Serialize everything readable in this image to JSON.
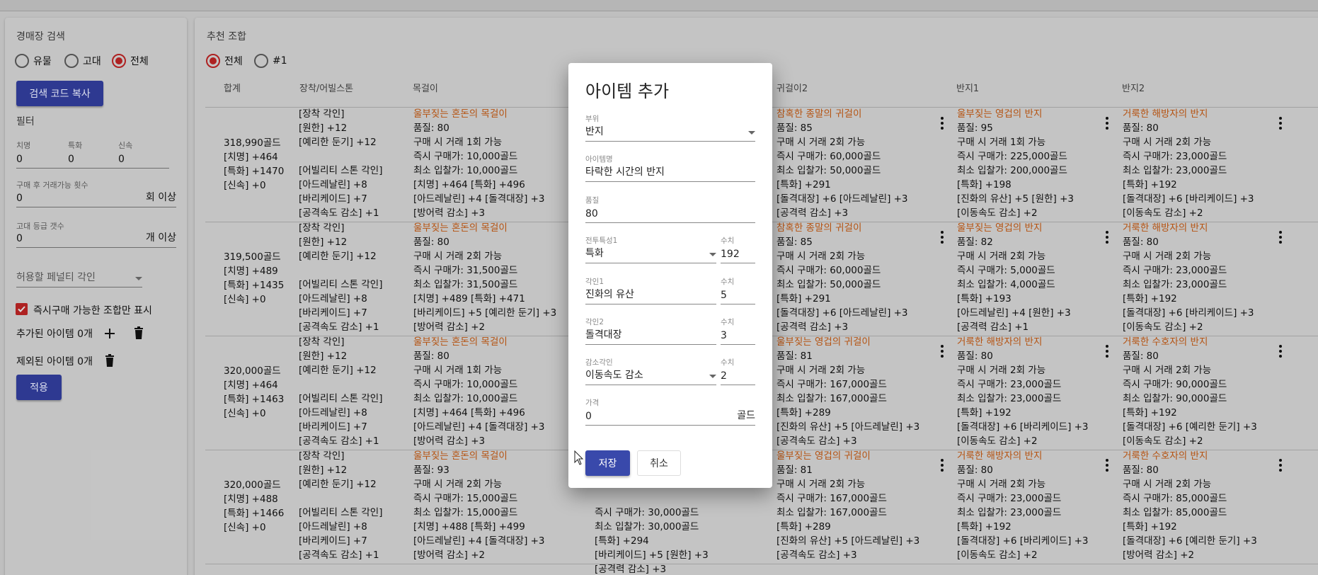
{
  "search": {
    "title": "경매장 검색",
    "radios": [
      {
        "label": "유물",
        "selected": false
      },
      {
        "label": "고대",
        "selected": false
      },
      {
        "label": "전체",
        "selected": true
      }
    ],
    "copy_button": "검색 코드 복사",
    "filter_title": "필터",
    "stats": [
      {
        "label": "치명",
        "value": "0"
      },
      {
        "label": "특화",
        "value": "0"
      },
      {
        "label": "신속",
        "value": "0"
      }
    ],
    "trade_label": "구매 후 거래가능 횟수",
    "trade_value": "0",
    "trade_suffix": "회 이상",
    "ancient_label": "고대 등급 갯수",
    "ancient_value": "0",
    "ancient_suffix": "개 이상",
    "penalty_placeholder": "허용할 페널티 각인",
    "instant_checkbox": {
      "label": "즉시구매 가능한 조합만 표시",
      "checked": true
    },
    "added_items": "추가된 아이템 0개",
    "excluded_items": "제외된 아이템 0개",
    "apply_button": "적용",
    "accent": "#2f3a93",
    "radio_color": "#b12323"
  },
  "combos": {
    "title": "추천 조합",
    "radios": [
      {
        "label": "전체",
        "selected": true
      },
      {
        "label": "#1",
        "selected": false
      }
    ],
    "headers": [
      "합계",
      "장착/어빌스톤",
      "목걸이",
      "",
      "",
      "귀걸이2",
      "반지1",
      "반지2"
    ],
    "rows": [
      {
        "total": [
          "318,990골드",
          "[치명] +464",
          "[특화] +1470",
          "[신속] +0"
        ],
        "equip": [
          "[장착 각인]",
          "[원한] +12",
          "[예리한 둔기] +12",
          "",
          "[어빌리티 스톤 각인]",
          "[아드레날린] +8",
          "[바리케이드] +7",
          "[공격속도 감소] +1"
        ],
        "necklace": {
          "title": "울부짖는 혼돈의 목걸이",
          "lines": [
            "품질: 80",
            "구매 시 거래 1회 가능",
            "즉시 구매가: 10,000골드",
            "최소 입찰가: 10,000골드",
            "[치명] +464 [특화] +496",
            "[아드레날린] +4 [돌격대장] +3",
            "[방어력 감소] +3"
          ]
        },
        "earring2": {
          "title": "참혹한 종말의 귀걸이",
          "lines": [
            "품질: 85",
            "구매 시 거래 2회 가능",
            "즉시 구매가: 60,000골드",
            "최소 입찰가: 50,000골드",
            "[특화] +291",
            "[돌격대장] +6 [아드레날린] +3",
            "[공격력 감소] +3"
          ]
        },
        "ring1": {
          "title": "울부짖는 영겁의 반지",
          "lines": [
            "품질: 95",
            "구매 시 거래 1회 가능",
            "즉시 구매가: 225,000골드",
            "최소 입찰가: 200,000골드",
            "[특화] +198",
            "[진화의 유산] +5 [원한] +3",
            "[이동속도 감소] +2"
          ]
        },
        "ring2": {
          "title": "거룩한 해방자의 반지",
          "lines": [
            "품질: 80",
            "구매 시 거래 2회 가능",
            "즉시 구매가: 23,000골드",
            "최소 입찰가: 23,000골드",
            "[특화] +192",
            "[돌격대장] +6 [바리케이드] +3",
            "[이동속도 감소] +2"
          ]
        }
      },
      {
        "total": [
          "319,500골드",
          "[치명] +489",
          "[특화] +1435",
          "[신속] +0"
        ],
        "equip": [
          "[장착 각인]",
          "[원한] +12",
          "[예리한 둔기] +12",
          "",
          "[어빌리티 스톤 각인]",
          "[아드레날린] +8",
          "[바리케이드] +7",
          "[공격속도 감소] +1"
        ],
        "necklace": {
          "title": "울부짖는 혼돈의 목걸이",
          "lines": [
            "품질: 80",
            "구매 시 거래 2회 가능",
            "즉시 구매가: 31,500골드",
            "최소 입찰가: 31,500골드",
            "[치명] +489 [특화] +471",
            "[바리케이드] +5 [예리한 둔기] +3",
            "[방어력 감소] +2"
          ]
        },
        "earring2": {
          "title": "참혹한 종말의 귀걸이",
          "lines": [
            "품질: 85",
            "구매 시 거래 2회 가능",
            "즉시 구매가: 60,000골드",
            "최소 입찰가: 50,000골드",
            "[특화] +291",
            "[돌격대장] +6 [아드레날린] +3",
            "[공격력 감소] +3"
          ]
        },
        "ring1": {
          "title": "울부짖는 영겁의 반지",
          "lines": [
            "품질: 82",
            "구매 시 거래 2회 가능",
            "즉시 구매가: 5,000골드",
            "최소 입찰가: 4,000골드",
            "[특화] +193",
            "[아드레날린] +4 [원한] +3",
            "[공격력 감소] +1"
          ]
        },
        "ring2": {
          "title": "거룩한 해방자의 반지",
          "lines": [
            "품질: 80",
            "구매 시 거래 2회 가능",
            "즉시 구매가: 23,000골드",
            "최소 입찰가: 23,000골드",
            "[특화] +192",
            "[돌격대장] +6 [바리케이드] +3",
            "[이동속도 감소] +2"
          ]
        }
      },
      {
        "total": [
          "320,000골드",
          "[치명] +464",
          "[특화] +1463",
          "[신속] +0"
        ],
        "equip": [
          "[장착 각인]",
          "[원한] +12",
          "[예리한 둔기] +12",
          "",
          "[어빌리티 스톤 각인]",
          "[아드레날린] +8",
          "[바리케이드] +7",
          "[공격속도 감소] +1"
        ],
        "necklace": {
          "title": "울부짖는 혼돈의 목걸이",
          "lines": [
            "품질: 80",
            "구매 시 거래 1회 가능",
            "즉시 구매가: 10,000골드",
            "최소 입찰가: 10,000골드",
            "[치명] +464 [특화] +496",
            "[아드레날린] +4 [돌격대장] +3",
            "[방어력 감소] +3"
          ]
        },
        "earring2": {
          "title": "울부짖는 영겁의 귀걸이",
          "lines": [
            "품질: 81",
            "구매 시 거래 2회 가능",
            "즉시 구매가: 167,000골드",
            "최소 입찰가: 167,000골드",
            "[특화] +289",
            "[진화의 유산] +5 [아드레날린] +3",
            "[공격속도 감소] +3"
          ]
        },
        "ring1": {
          "title": "거룩한 해방자의 반지",
          "lines": [
            "품질: 80",
            "구매 시 거래 2회 가능",
            "즉시 구매가: 23,000골드",
            "최소 입찰가: 23,000골드",
            "[특화] +192",
            "[돌격대장] +6 [바리케이드] +3",
            "[이동속도 감소] +2"
          ]
        },
        "ring2": {
          "title": "거룩한 수호자의 반지",
          "lines": [
            "품질: 80",
            "구매 시 거래 2회 가능",
            "즉시 구매가: 90,000골드",
            "최소 입찰가: 90,000골드",
            "[특화] +192",
            "[돌격대장] +6 [예리한 둔기] +3",
            "[이동속도 감소] +2"
          ]
        }
      },
      {
        "total": [
          "320,000골드",
          "[치명] +488",
          "[특화] +1466",
          "[신속] +0"
        ],
        "equip": [
          "[장착 각인]",
          "[원한] +12",
          "[예리한 둔기] +12",
          "",
          "[어빌리티 스톤 각인]",
          "[아드레날린] +8",
          "[바리케이드] +7",
          "[공격속도 감소] +1"
        ],
        "necklace": {
          "title": "울부짖는 혼돈의 목걸이",
          "lines": [
            "품질: 93",
            "구매 시 거래 2회 가능",
            "즉시 구매가: 15,000골드",
            "최소 입찰가: 15,000골드",
            "[치명] +488 [특화] +499",
            "[아드레날린] +4 [돌격대장] +3",
            "[방어력 감소] +2"
          ]
        },
        "earring1": {
          "lines": [
            "즉시 구매가: 30,000골드",
            "최소 입찰가: 30,000골드",
            "[특화] +294",
            "[바리케이드] +5 [원한] +3",
            "[공격력 감소] +3"
          ]
        },
        "earring2": {
          "title": "울부짖는 영겁의 귀걸이",
          "lines": [
            "품질: 81",
            "구매 시 거래 2회 가능",
            "즉시 구매가: 167,000골드",
            "최소 입찰가: 167,000골드",
            "[특화] +289",
            "[진화의 유산] +5 [아드레날린] +3",
            "[공격속도 감소] +3"
          ]
        },
        "ring1": {
          "title": "거룩한 해방자의 반지",
          "lines": [
            "품질: 80",
            "구매 시 거래 2회 가능",
            "즉시 구매가: 23,000골드",
            "최소 입찰가: 23,000골드",
            "[특화] +192",
            "[돌격대장] +6 [바리케이드] +3",
            "[이동속도 감소] +2"
          ]
        },
        "ring2": {
          "title": "거룩한 수호자의 반지",
          "lines": [
            "품질: 80",
            "구매 시 거래 2회 가능",
            "즉시 구매가: 85,000골드",
            "최소 입찰가: 85,000골드",
            "[특화] +192",
            "[돌격대장] +6 [예리한 둔기] +3",
            "[방어력 감소] +2"
          ]
        }
      }
    ],
    "title_color": "#b85412"
  },
  "dialog": {
    "title": "아이템 추가",
    "part_label": "부위",
    "part_value": "반지",
    "name_label": "아이템명",
    "name_value": "타락한 시간의 반지",
    "quality_label": "품질",
    "quality_value": "80",
    "stat_label": "전투특성1",
    "stat_value": "특화",
    "stat_num_label": "수치",
    "stat_num": "192",
    "eng1_label": "각인1",
    "eng1_value": "진화의 유산",
    "eng1_num_label": "수치",
    "eng1_num": "5",
    "eng2_label": "각인2",
    "eng2_value": "돌격대장",
    "eng2_num_label": "수치",
    "eng2_num": "3",
    "neg_label": "감소각인",
    "neg_value": "이동속도 감소",
    "neg_num_label": "수치",
    "neg_num": "2",
    "price_label": "가격",
    "price_value": "0",
    "price_suffix": "골드",
    "save_button": "저장",
    "cancel_button": "취소"
  }
}
